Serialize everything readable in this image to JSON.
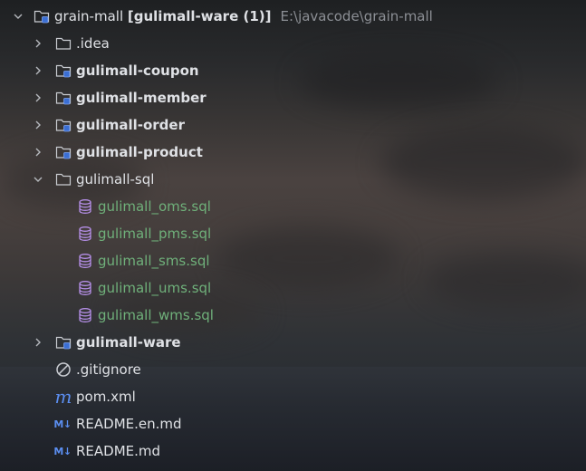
{
  "project": {
    "name": "grain-mall",
    "module": "[gulimall-ware (1)]",
    "path": "E:\\javacode\\grain-mall",
    "icon": "module-folder-icon"
  },
  "items": [
    {
      "label": ".idea",
      "icon": "folder-icon",
      "expand": "collapsed"
    },
    {
      "label": "gulimall-coupon",
      "icon": "module-folder-icon",
      "expand": "collapsed"
    },
    {
      "label": "gulimall-member",
      "icon": "module-folder-icon",
      "expand": "collapsed"
    },
    {
      "label": "gulimall-order",
      "icon": "module-folder-icon",
      "expand": "collapsed"
    },
    {
      "label": "gulimall-product",
      "icon": "module-folder-icon",
      "expand": "collapsed"
    },
    {
      "label": "gulimall-sql",
      "icon": "folder-icon",
      "expand": "expanded"
    },
    {
      "label": "gulimall_oms.sql",
      "icon": "database-icon"
    },
    {
      "label": "gulimall_pms.sql",
      "icon": "database-icon"
    },
    {
      "label": "gulimall_sms.sql",
      "icon": "database-icon"
    },
    {
      "label": "gulimall_ums.sql",
      "icon": "database-icon"
    },
    {
      "label": "gulimall_wms.sql",
      "icon": "database-icon"
    },
    {
      "label": "gulimall-ware",
      "icon": "module-folder-icon",
      "expand": "collapsed"
    },
    {
      "label": ".gitignore",
      "icon": "ignore-icon"
    },
    {
      "label": "pom.xml",
      "icon": "maven-icon",
      "icon_glyph": "m"
    },
    {
      "label": "README.en.md",
      "icon": "markdown-icon",
      "icon_glyph": "M↓"
    },
    {
      "label": "README.md",
      "icon": "markdown-icon",
      "icon_glyph": "M↓"
    }
  ],
  "colors": {
    "text": "#dfe1e5",
    "sql_text": "#6fb07a",
    "path_text": "#8c8f95",
    "module_badge": "#4a7fe0",
    "database_icon": "#b48ee6",
    "markdown_icon": "#5b8ef0"
  }
}
